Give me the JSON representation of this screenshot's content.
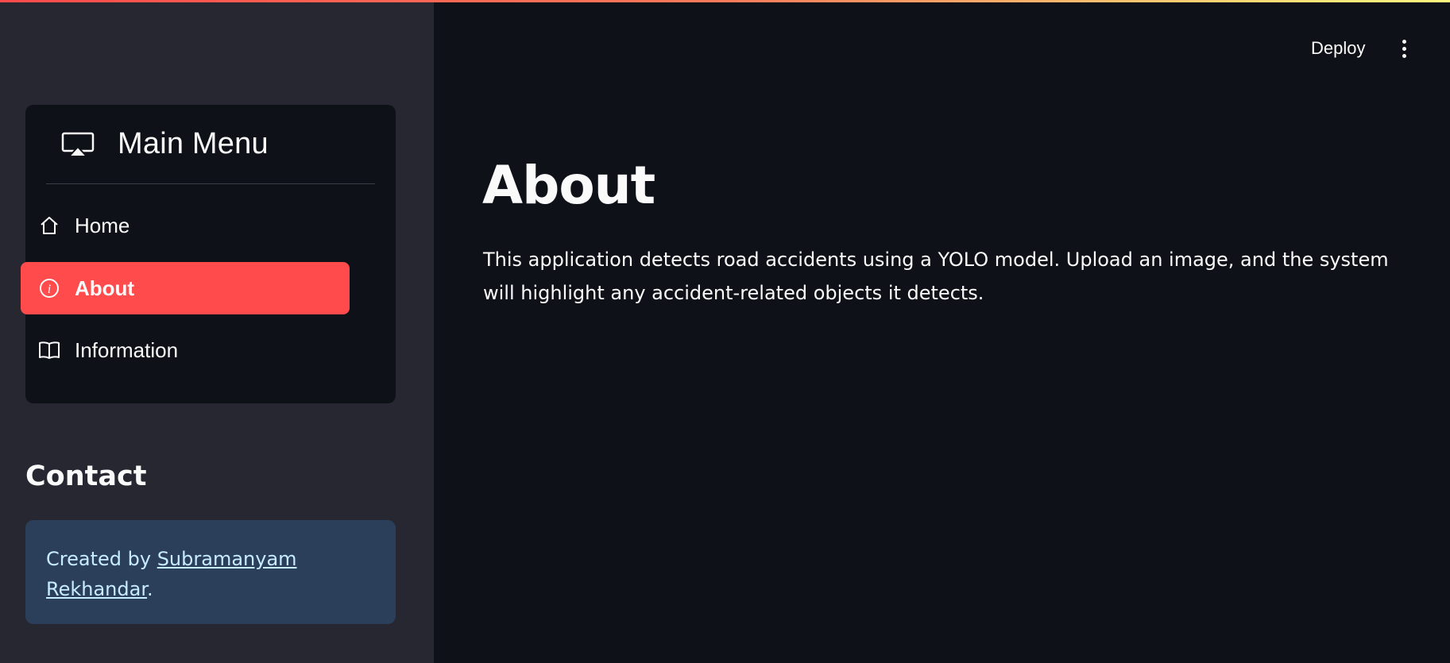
{
  "sidebar": {
    "menu": {
      "title": "Main Menu",
      "title_icon": "airplay-icon",
      "items": [
        {
          "label": "Home",
          "icon": "house-icon",
          "active": false
        },
        {
          "label": "About",
          "icon": "info-circle-icon",
          "active": true
        },
        {
          "label": "Information",
          "icon": "book-icon",
          "active": false
        }
      ]
    },
    "contact": {
      "heading": "Contact",
      "prefix": "Created by ",
      "author_link": "Subramanyam Rekhandar",
      "suffix": "."
    }
  },
  "header": {
    "deploy_label": "Deploy",
    "menu_icon": "kebab-menu-icon"
  },
  "main": {
    "title": "About",
    "description": "This application detects road accidents using a YOLO model. Upload an image, and the system will highlight any accident-related objects it detects."
  },
  "colors": {
    "accent": "#ff4b4b",
    "sidebar_bg": "#262730",
    "main_bg": "#0e1117",
    "contact_box_bg": "#2b3f5a",
    "contact_text": "#c7ebff"
  }
}
